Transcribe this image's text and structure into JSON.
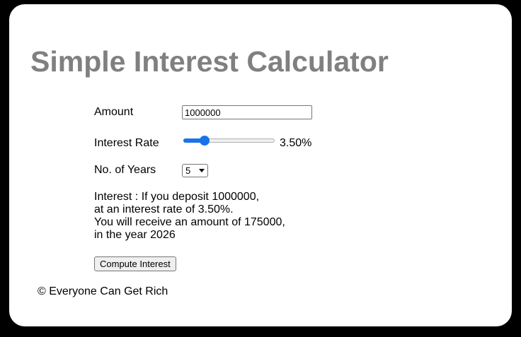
{
  "title": "Simple Interest Calculator",
  "form": {
    "amount_label": "Amount",
    "amount_value": "1000000",
    "rate_label": "Interest Rate",
    "rate_display": "3.50%",
    "rate_slider_fraction": 0.2,
    "years_label": "No. of Years",
    "years_selected": "5"
  },
  "result": {
    "line1": "Interest : If you deposit 1000000,",
    "line2": "at an interest rate of 3.50%.",
    "line3": "You will receive an amount of 175000,",
    "line4": "in the year 2026"
  },
  "compute_label": "Compute Interest",
  "footer": "© Everyone Can Get Rich",
  "colors": {
    "title": "#808080",
    "accent": "#1a73e8",
    "background": "#000000",
    "card": "#ffffff"
  }
}
